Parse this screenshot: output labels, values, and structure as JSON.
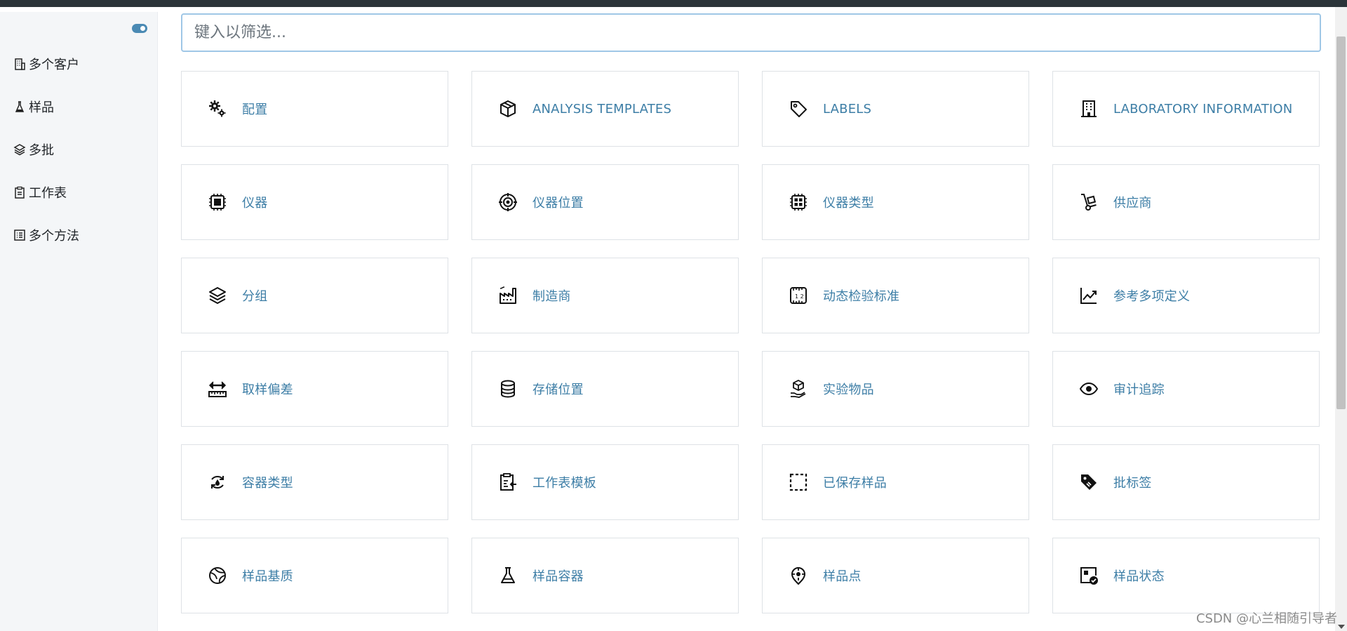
{
  "sidebar": {
    "items": [
      {
        "label": "多个客户",
        "icon": "building-icon"
      },
      {
        "label": "样品",
        "icon": "flask-icon"
      },
      {
        "label": "多批",
        "icon": "layers-icon"
      },
      {
        "label": "工作表",
        "icon": "clipboard-icon"
      },
      {
        "label": "多个方法",
        "icon": "list-icon"
      }
    ]
  },
  "filter": {
    "placeholder": "键入以筛选..."
  },
  "cards": [
    {
      "label": "配置",
      "icon": "gears-icon"
    },
    {
      "label": "ANALYSIS TEMPLATES",
      "icon": "box-icon"
    },
    {
      "label": "LABELS",
      "icon": "tag-icon"
    },
    {
      "label": "LABORATORY INFORMATION",
      "icon": "building-icon"
    },
    {
      "label": "仪器",
      "icon": "cpu-icon"
    },
    {
      "label": "仪器位置",
      "icon": "target-icon"
    },
    {
      "label": "仪器类型",
      "icon": "cpu-grid-icon"
    },
    {
      "label": "供应商",
      "icon": "hand-truck-icon"
    },
    {
      "label": "分组",
      "icon": "layers-icon"
    },
    {
      "label": "制造商",
      "icon": "factory-icon"
    },
    {
      "label": "动态检验标准",
      "icon": "ruler-icon"
    },
    {
      "label": "参考多项定义",
      "icon": "chart-line-icon"
    },
    {
      "label": "取样偏差",
      "icon": "ruler-arrows-icon"
    },
    {
      "label": "存储位置",
      "icon": "database-icon"
    },
    {
      "label": "实验物品",
      "icon": "box-hand-icon"
    },
    {
      "label": "审计追踪",
      "icon": "eye-icon"
    },
    {
      "label": "容器类型",
      "icon": "recycle-icon"
    },
    {
      "label": "工作表模板",
      "icon": "clipboard-import-icon"
    },
    {
      "label": "已保存样品",
      "icon": "dashed-square-icon"
    },
    {
      "label": "批标签",
      "icon": "tags-icon"
    },
    {
      "label": "样品基质",
      "icon": "globe-icon"
    },
    {
      "label": "样品容器",
      "icon": "flask-icon"
    },
    {
      "label": "样品点",
      "icon": "map-pin-icon"
    },
    {
      "label": "样品状态",
      "icon": "status-check-icon"
    }
  ],
  "watermark": "CSDN @心兰相随引导者"
}
